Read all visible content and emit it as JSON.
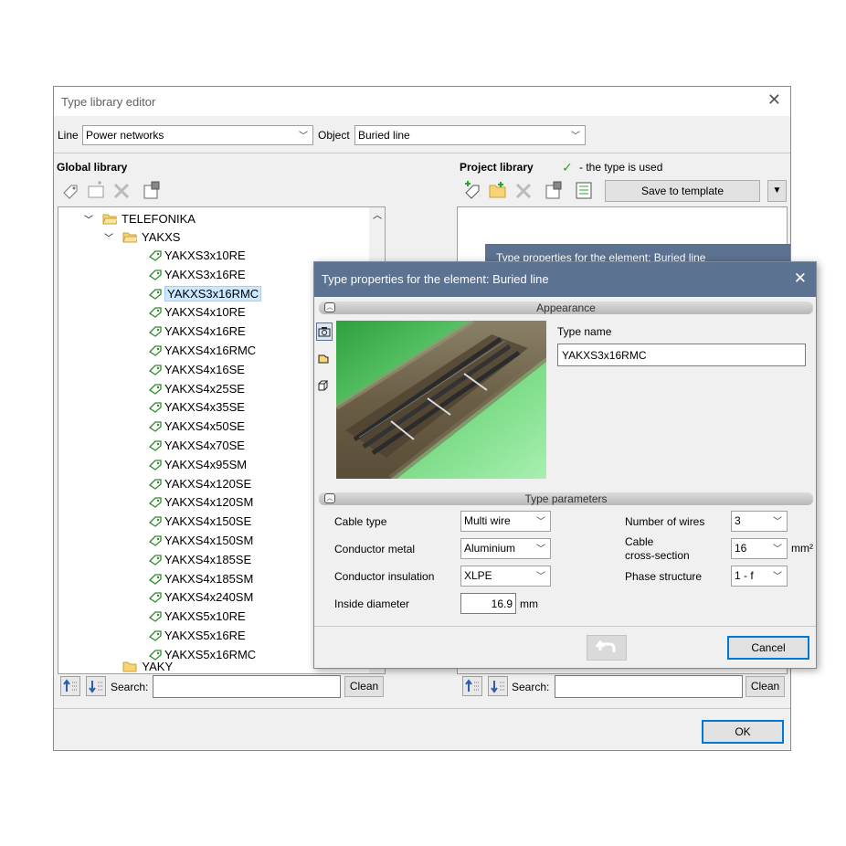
{
  "window": {
    "title": "Type library editor",
    "close_icon": "close-icon",
    "line_label": "Line",
    "line_value": "Power networks",
    "object_label": "Object",
    "object_value": "Buried line",
    "ok_label": "OK"
  },
  "global_library": {
    "title": "Global library",
    "tree": {
      "root": "TELEFONIKA",
      "group": "YAKXS",
      "items": [
        "YAKXS3x10RE",
        "YAKXS3x16RE",
        "YAKXS3x16RMC",
        "YAKXS4x10RE",
        "YAKXS4x16RE",
        "YAKXS4x16RMC",
        "YAKXS4x16SE",
        "YAKXS4x25SE",
        "YAKXS4x35SE",
        "YAKXS4x50SE",
        "YAKXS4x70SE",
        "YAKXS4x95SM",
        "YAKXS4x120SE",
        "YAKXS4x120SM",
        "YAKXS4x150SE",
        "YAKXS4x150SM",
        "YAKXS4x185SE",
        "YAKXS4x185SM",
        "YAKXS4x240SM",
        "YAKXS5x10RE",
        "YAKXS5x16RE",
        "YAKXS5x16RMC"
      ],
      "selected": "YAKXS3x16RMC",
      "next_partial": "YAKY"
    },
    "search_label": "Search:",
    "search_value": "",
    "clean_label": "Clean"
  },
  "project_library": {
    "title": "Project library",
    "legend": "- the type is used",
    "save_template_label": "Save to template",
    "search_label": "Search:",
    "search_value": "",
    "clean_label": "Clean",
    "behind_title": "Type properties for the element: Buried line"
  },
  "dialog": {
    "title": "Type properties for the element: Buried line",
    "appearance_label": "Appearance",
    "type_name_label": "Type name",
    "type_name_value": "YAKXS3x16RMC",
    "params_label": "Type parameters",
    "cable_type_label": "Cable type",
    "cable_type_value": "Multi wire",
    "conductor_metal_label": "Conductor metal",
    "conductor_metal_value": "Aluminium",
    "conductor_insulation_label": "Conductor insulation",
    "conductor_insulation_value": "XLPE",
    "inside_diameter_label": "Inside diameter",
    "inside_diameter_value": "16.9",
    "inside_diameter_unit": "mm",
    "number_of_wires_label": "Number of wires",
    "number_of_wires_value": "3",
    "cross_section_label_1": "Cable",
    "cross_section_label_2": "cross-section",
    "cross_section_value": "16",
    "cross_section_unit": "mm²",
    "phase_structure_label": "Phase structure",
    "phase_structure_value": "1 - f",
    "cancel_label": "Cancel"
  },
  "colors": {
    "dialog_title_bg": "#5c7291",
    "selection_bg": "#cce8ff",
    "default_button_border": "#0078d7",
    "check_green": "#2aa52a"
  }
}
